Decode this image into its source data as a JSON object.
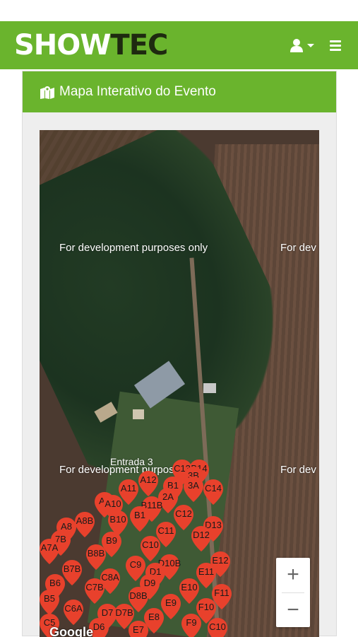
{
  "navbar": {
    "logo_part1": "SHOW",
    "logo_part2": "TEC",
    "user_icon": "user-icon",
    "menu_icon": "hamburger-menu-icon"
  },
  "card": {
    "title": "Mapa Interativo do Evento",
    "title_icon": "map-marked-icon"
  },
  "map": {
    "watermark": "For development purposes only",
    "watermark_cut": "For dev",
    "entrance_label": "Entrada 3",
    "zoom_in": "+",
    "zoom_out": "−",
    "attribution": "Google",
    "pins": [
      {
        "label": "B14"
      },
      {
        "label": "C13"
      },
      {
        "label": "3B"
      },
      {
        "label": "A12"
      },
      {
        "label": "B1"
      },
      {
        "label": "3A"
      },
      {
        "label": "C14"
      },
      {
        "label": "A11"
      },
      {
        "label": "2A"
      },
      {
        "label": "A1"
      },
      {
        "label": "A10"
      },
      {
        "label": "B11B"
      },
      {
        "label": "C12"
      },
      {
        "label": "B10"
      },
      {
        "label": "B1"
      },
      {
        "label": "A8B"
      },
      {
        "label": "A8"
      },
      {
        "label": "D13"
      },
      {
        "label": "C11"
      },
      {
        "label": "D12"
      },
      {
        "label": "7B"
      },
      {
        "label": "A7A"
      },
      {
        "label": "B9"
      },
      {
        "label": "C10"
      },
      {
        "label": "B8B"
      },
      {
        "label": "E12"
      },
      {
        "label": "D10B"
      },
      {
        "label": "C9"
      },
      {
        "label": "B7B"
      },
      {
        "label": "D1"
      },
      {
        "label": "E11"
      },
      {
        "label": "C8A"
      },
      {
        "label": "B6"
      },
      {
        "label": "C7B"
      },
      {
        "label": "D9"
      },
      {
        "label": "E10"
      },
      {
        "label": "D8B"
      },
      {
        "label": "F11"
      },
      {
        "label": "B5"
      },
      {
        "label": "E9"
      },
      {
        "label": "F10"
      },
      {
        "label": "C6A"
      },
      {
        "label": "D7"
      },
      {
        "label": "D7B"
      },
      {
        "label": "E8"
      },
      {
        "label": "F9"
      },
      {
        "label": "D6"
      },
      {
        "label": "E7"
      },
      {
        "label": "C10"
      },
      {
        "label": "C5"
      }
    ]
  },
  "colors": {
    "brand": "#6ab42d",
    "pin": "#e8412c"
  }
}
